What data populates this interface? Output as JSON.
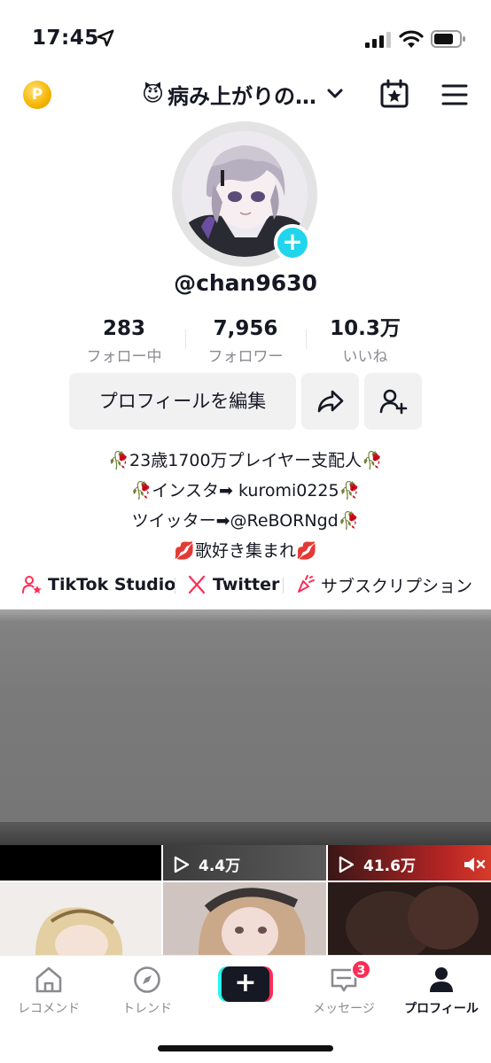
{
  "status_bar": {
    "time": "17:45"
  },
  "header": {
    "coin_letter": "P",
    "title_emoji": "😈",
    "title": "病み上がりの…"
  },
  "profile": {
    "username": "@chan9630",
    "avatar_plus": "+",
    "stats": [
      {
        "value": "283",
        "label": "フォロー中"
      },
      {
        "value": "7,956",
        "label": "フォロワー"
      },
      {
        "value": "10.3万",
        "label": "いいね"
      }
    ],
    "edit_button": "プロフィールを編集"
  },
  "bio": {
    "rose": "🥀",
    "kiss": "💋",
    "line1": "23歳1700万プレイヤー支配人",
    "line2_prefix": "インスタ➡ ",
    "line2_handle": "kuromi0225",
    "line3": "ツイッター➡@ReBORNgd",
    "line4": "歌好き集まれ"
  },
  "links": [
    {
      "label": "TikTok Studio",
      "icon": "studio-icon"
    },
    {
      "label": "Twitter",
      "icon": "x-icon"
    },
    {
      "label": "サブスクリプション",
      "icon": "subscription-icon"
    }
  ],
  "videos": {
    "tile2_views": "4.4万",
    "tile3_views": "41.6万"
  },
  "bottom_nav": {
    "home": "レコメンド",
    "discover": "トレンド",
    "create": "+",
    "inbox": "メッセージ",
    "inbox_badge": "3",
    "profile": "プロフィール"
  },
  "colors": {
    "accent_cyan": "#20d5ec",
    "accent_red": "#fe2c55",
    "text_primary": "#161823",
    "text_secondary": "#8a8b91"
  }
}
